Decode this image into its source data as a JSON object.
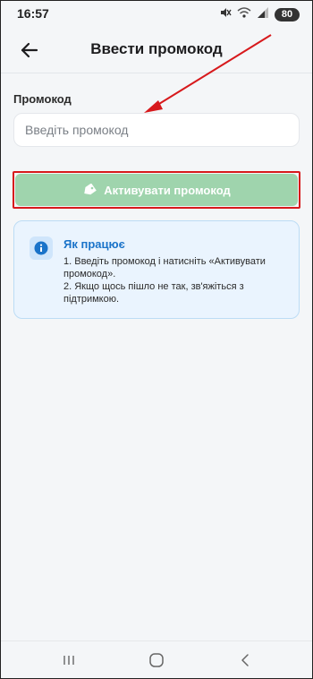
{
  "status_bar": {
    "time": "16:57",
    "battery_level": "80",
    "icons": [
      "mute-icon",
      "wifi-icon",
      "signal-icon",
      "battery-icon"
    ]
  },
  "app_bar": {
    "title": "Ввести промокод",
    "back_icon": "arrow-left-icon"
  },
  "form": {
    "label": "Промокод",
    "input_value": "",
    "input_placeholder": "Введіть промокод",
    "button_label": "Активувати промокод",
    "button_icon": "tag-icon"
  },
  "info": {
    "icon": "info-icon",
    "title": "Як працює",
    "lines": [
      "1. Введіть промокод і натисніть «Активувати промокод».",
      "2. Якщо щось пішло не так, зв'яжіться з підтримкою."
    ]
  },
  "nav_bar": {
    "buttons": [
      "recents-icon",
      "home-icon",
      "back-icon"
    ]
  },
  "colors": {
    "background": "#f4f6f8",
    "button": "#9fd4ad",
    "info_title": "#1a73c9",
    "annotation": "#d7191c"
  }
}
